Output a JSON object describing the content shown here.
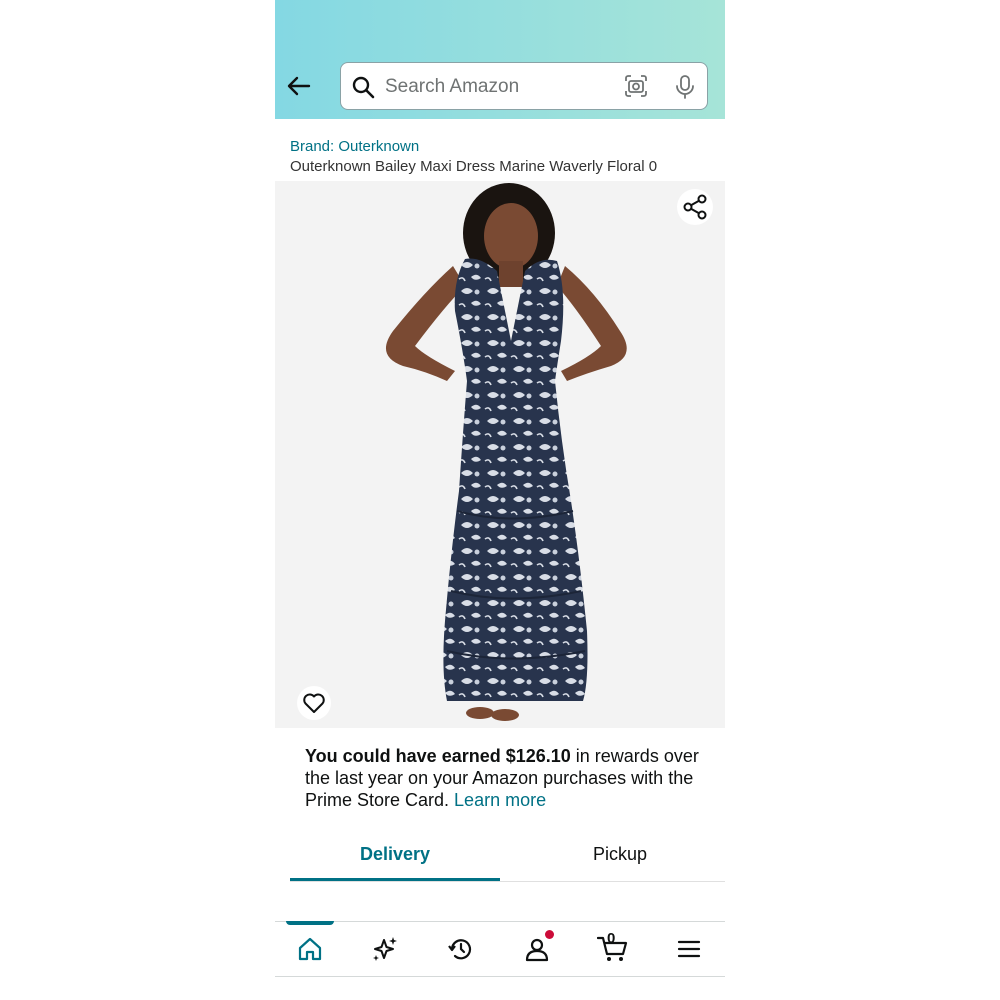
{
  "header": {
    "search_placeholder": "Search Amazon",
    "back_icon": "arrow-left-icon",
    "search_icon": "magnifier-icon",
    "camera_icon": "camera-lens-icon",
    "mic_icon": "microphone-icon"
  },
  "product": {
    "brand": "Brand: Outerknown",
    "title": "Outerknown Bailey Maxi Dress Marine Waverly Floral 0",
    "share_icon": "share-icon",
    "wishlist_icon": "heart-icon"
  },
  "rewards": {
    "bold": "You could have earned $126.10",
    "text": " in rewards over the last year on your Amazon purchases with the Prime Store Card. ",
    "link": "Learn more"
  },
  "tabs": [
    {
      "label": "Delivery",
      "active": true
    },
    {
      "label": "Pickup",
      "active": false
    }
  ],
  "bottom_nav": {
    "items": [
      "home-icon",
      "sparkle-icon",
      "history-icon",
      "account-icon",
      "cart-icon",
      "menu-icon"
    ],
    "cart_count": "0",
    "colors": {
      "accent": "#007185",
      "badge": "#cc0c39"
    }
  }
}
